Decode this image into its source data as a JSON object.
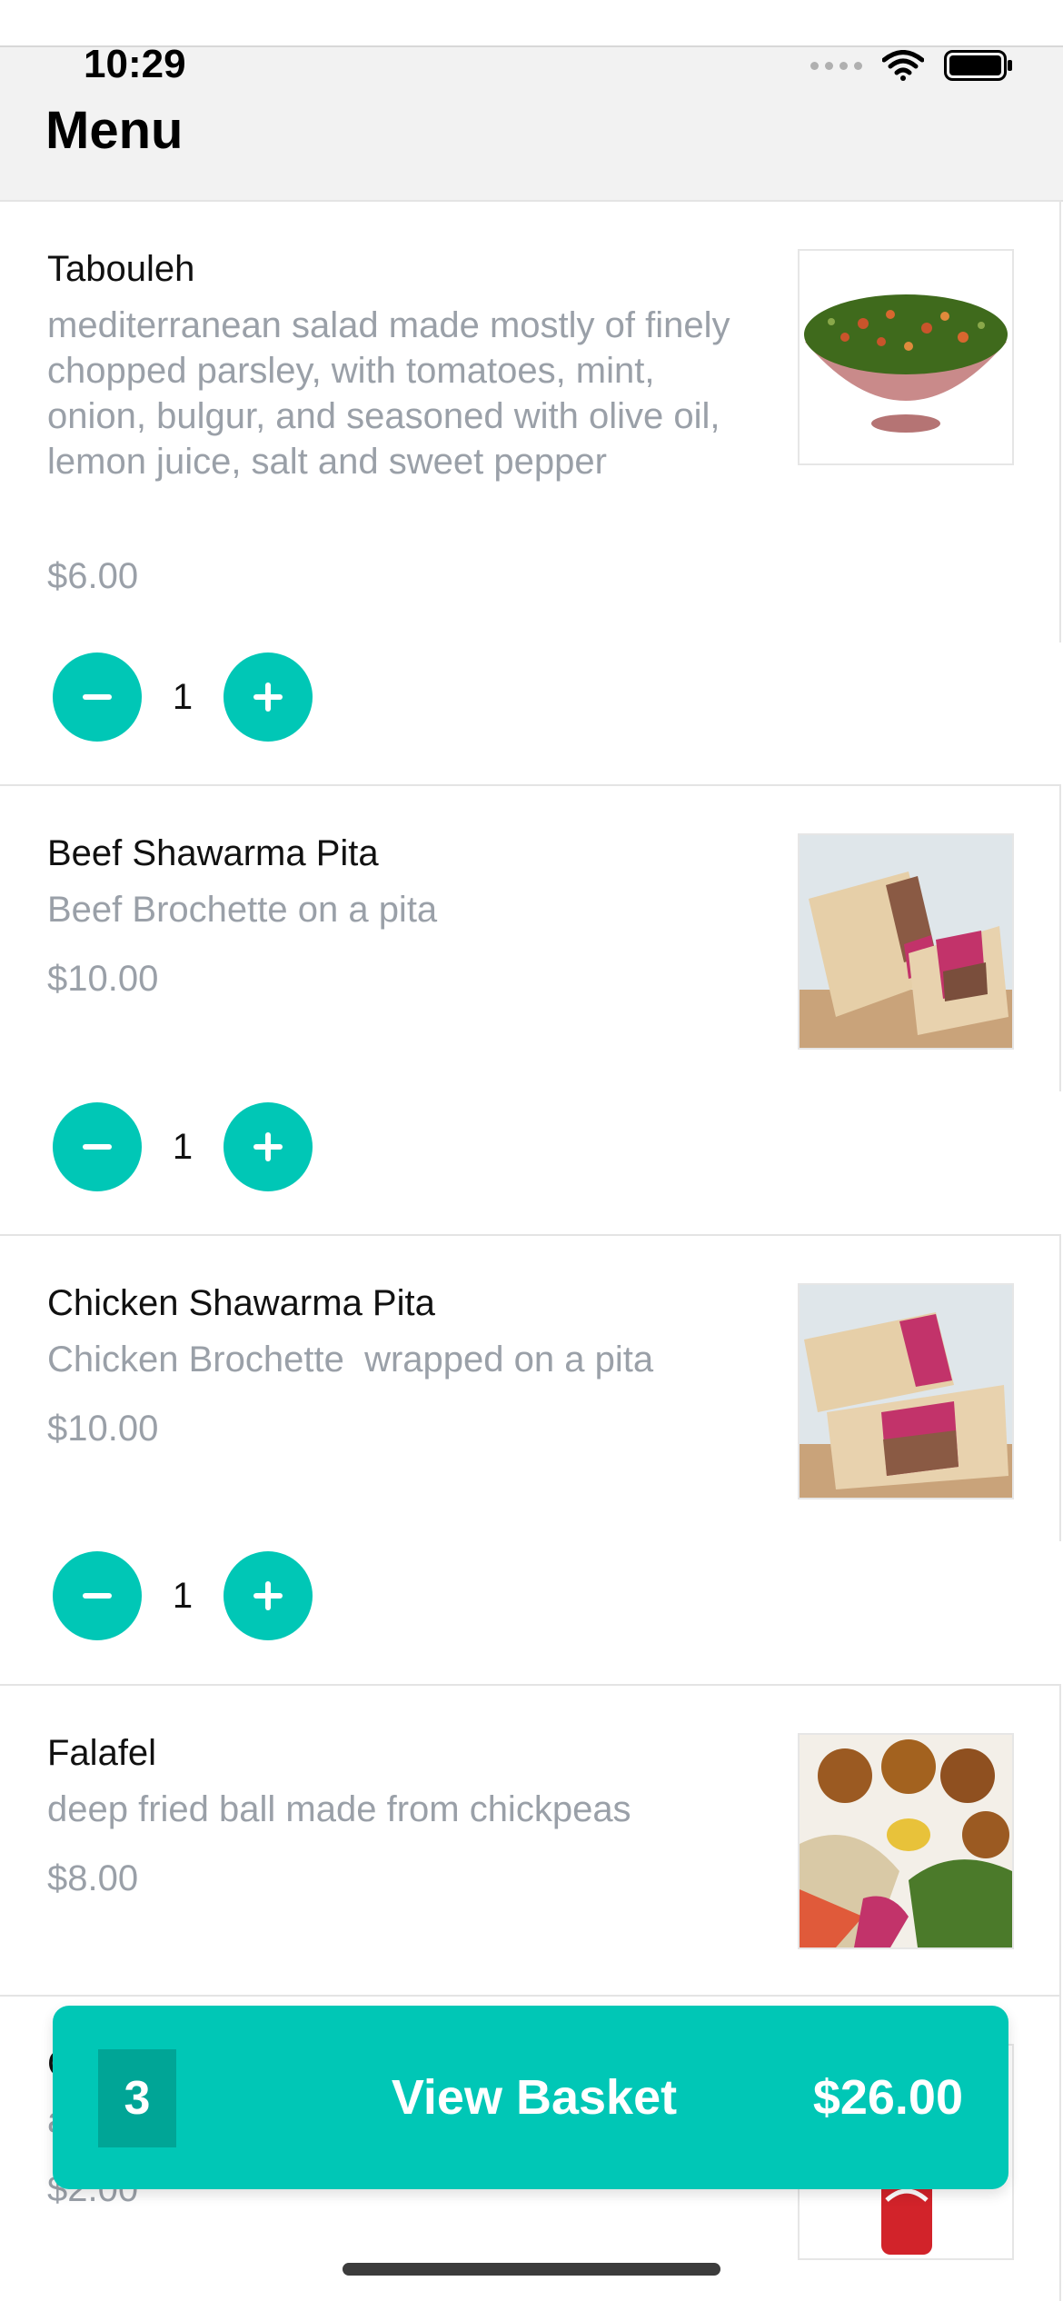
{
  "status": {
    "time": "10:29"
  },
  "header": {
    "title": "Menu"
  },
  "items": [
    {
      "name": "Tabouleh",
      "description": "mediterranean salad made mostly of finely chopped parsley, with tomatoes, mint, onion, bulgur, and seasoned with olive oil, lemon juice, salt and sweet pepper",
      "price": "$6.00",
      "quantity": "1",
      "image_icon": "salad-bowl-photo"
    },
    {
      "name": "Beef Shawarma Pita",
      "description": "Beef Brochette on a pita",
      "price": "$10.00",
      "quantity": "1",
      "image_icon": "wrap-photo"
    },
    {
      "name": "Chicken Shawarma Pita",
      "description": "Chicken Brochette  wrapped on a pita",
      "price": "$10.00",
      "quantity": "1",
      "image_icon": "wrap-photo"
    },
    {
      "name": "Falafel",
      "description": "deep fried ball made from chickpeas",
      "price": "$8.00",
      "image_icon": "falafel-plate-photo"
    },
    {
      "partial_name": "C",
      "partial_description": "a",
      "price": "$2.00",
      "image_icon": "soda-can-photo"
    }
  ],
  "basket": {
    "count": "3",
    "label": "View Basket",
    "total": "$26.00"
  },
  "colors": {
    "accent": "#00c7b6",
    "accent_dark": "#00a596",
    "muted_text": "#9aa0a8"
  }
}
